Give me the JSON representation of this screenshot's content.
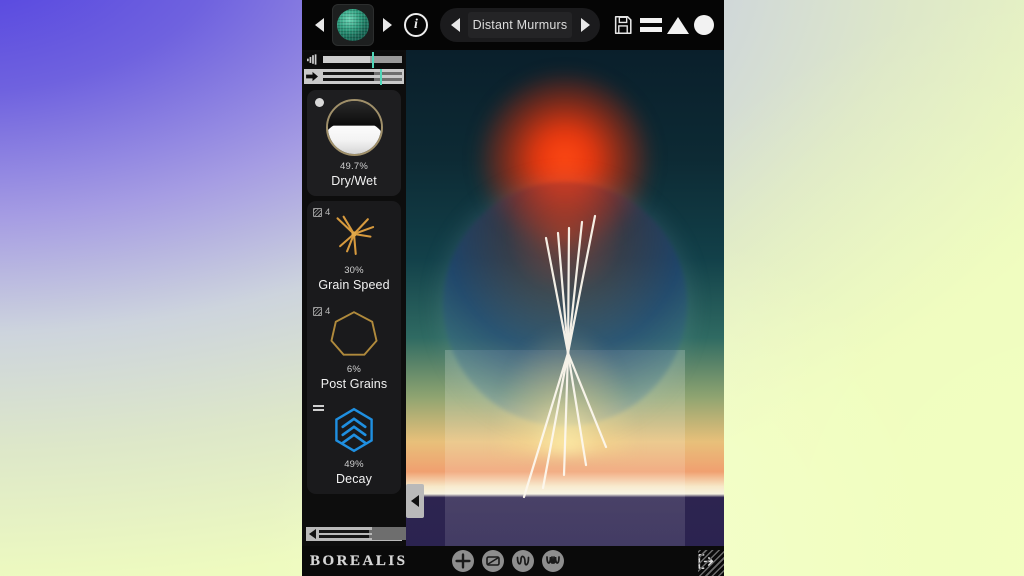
{
  "app": {
    "name": "BOREALIS",
    "window_title": "Borealis"
  },
  "topbar": {
    "prev_preset_icon": "triangle-left-icon",
    "next_preset_icon": "triangle-right-icon",
    "thumbnail_alt": "preset-thumbnail",
    "info_label": "i",
    "preset_name": "Distant Murmurs",
    "preset_prev_icon": "triangle-left-icon",
    "preset_next_icon": "triangle-right-icon",
    "save_icon": "floppy-disk-icon",
    "brand_icon": "bars-triangle-circle-logo"
  },
  "rack": {
    "meters": [
      {
        "icon": "speaker-volume-icon",
        "value": 60,
        "marker": 62
      },
      {
        "icon": "arrow-right-icon",
        "value": 65,
        "marker": 72
      }
    ],
    "modules": [
      {
        "id": "dry-wet",
        "label": "Dry/Wet",
        "value": "49.7%",
        "icon": "half-filled-knob-icon",
        "badge": null,
        "led": true
      },
      {
        "id": "grain-speed",
        "label": "Grain Speed",
        "value": "30%",
        "icon": "starburst-icon",
        "badge": {
          "icon": "grid-square-icon",
          "text": "4"
        },
        "led": false
      },
      {
        "id": "post-grains",
        "label": "Post Grains",
        "value": "6%",
        "icon": "heptagon-icon",
        "badge": {
          "icon": "grid-square-icon",
          "text": "4"
        },
        "led": false
      },
      {
        "id": "decay",
        "label": "Decay",
        "value": "49%",
        "icon": "hex-chevron-icon",
        "badge": {
          "icon": "equals-icon",
          "text": ""
        },
        "led": false
      }
    ],
    "hscroll_icon": "triangle-left-icon"
  },
  "visual": {
    "name": "granular-visualizer",
    "scroll_icon": "triangle-left-icon"
  },
  "bottombar": {
    "logo": "BOREALIS",
    "mod_buttons": [
      {
        "id": "add-mod",
        "icon": "plus-icon"
      },
      {
        "id": "envelope-mod",
        "icon": "envelope-ramp-icon"
      },
      {
        "id": "lfo-mod",
        "icon": "sine-wave-icon"
      },
      {
        "id": "random-mod",
        "icon": "double-wave-icon"
      }
    ],
    "exit_icon": "exit-arrow-icon",
    "resize_grip_icon": "resize-grip-icon"
  },
  "colors": {
    "accent_teal": "#4fd6b8",
    "accent_blue": "#1f8fe0",
    "accent_amber": "#d79a3e",
    "panel_bg": "#1e1e20",
    "window_bg": "#0a0a0a",
    "text_primary": "#f2f2f2",
    "text_secondary": "#cfcfcf"
  }
}
